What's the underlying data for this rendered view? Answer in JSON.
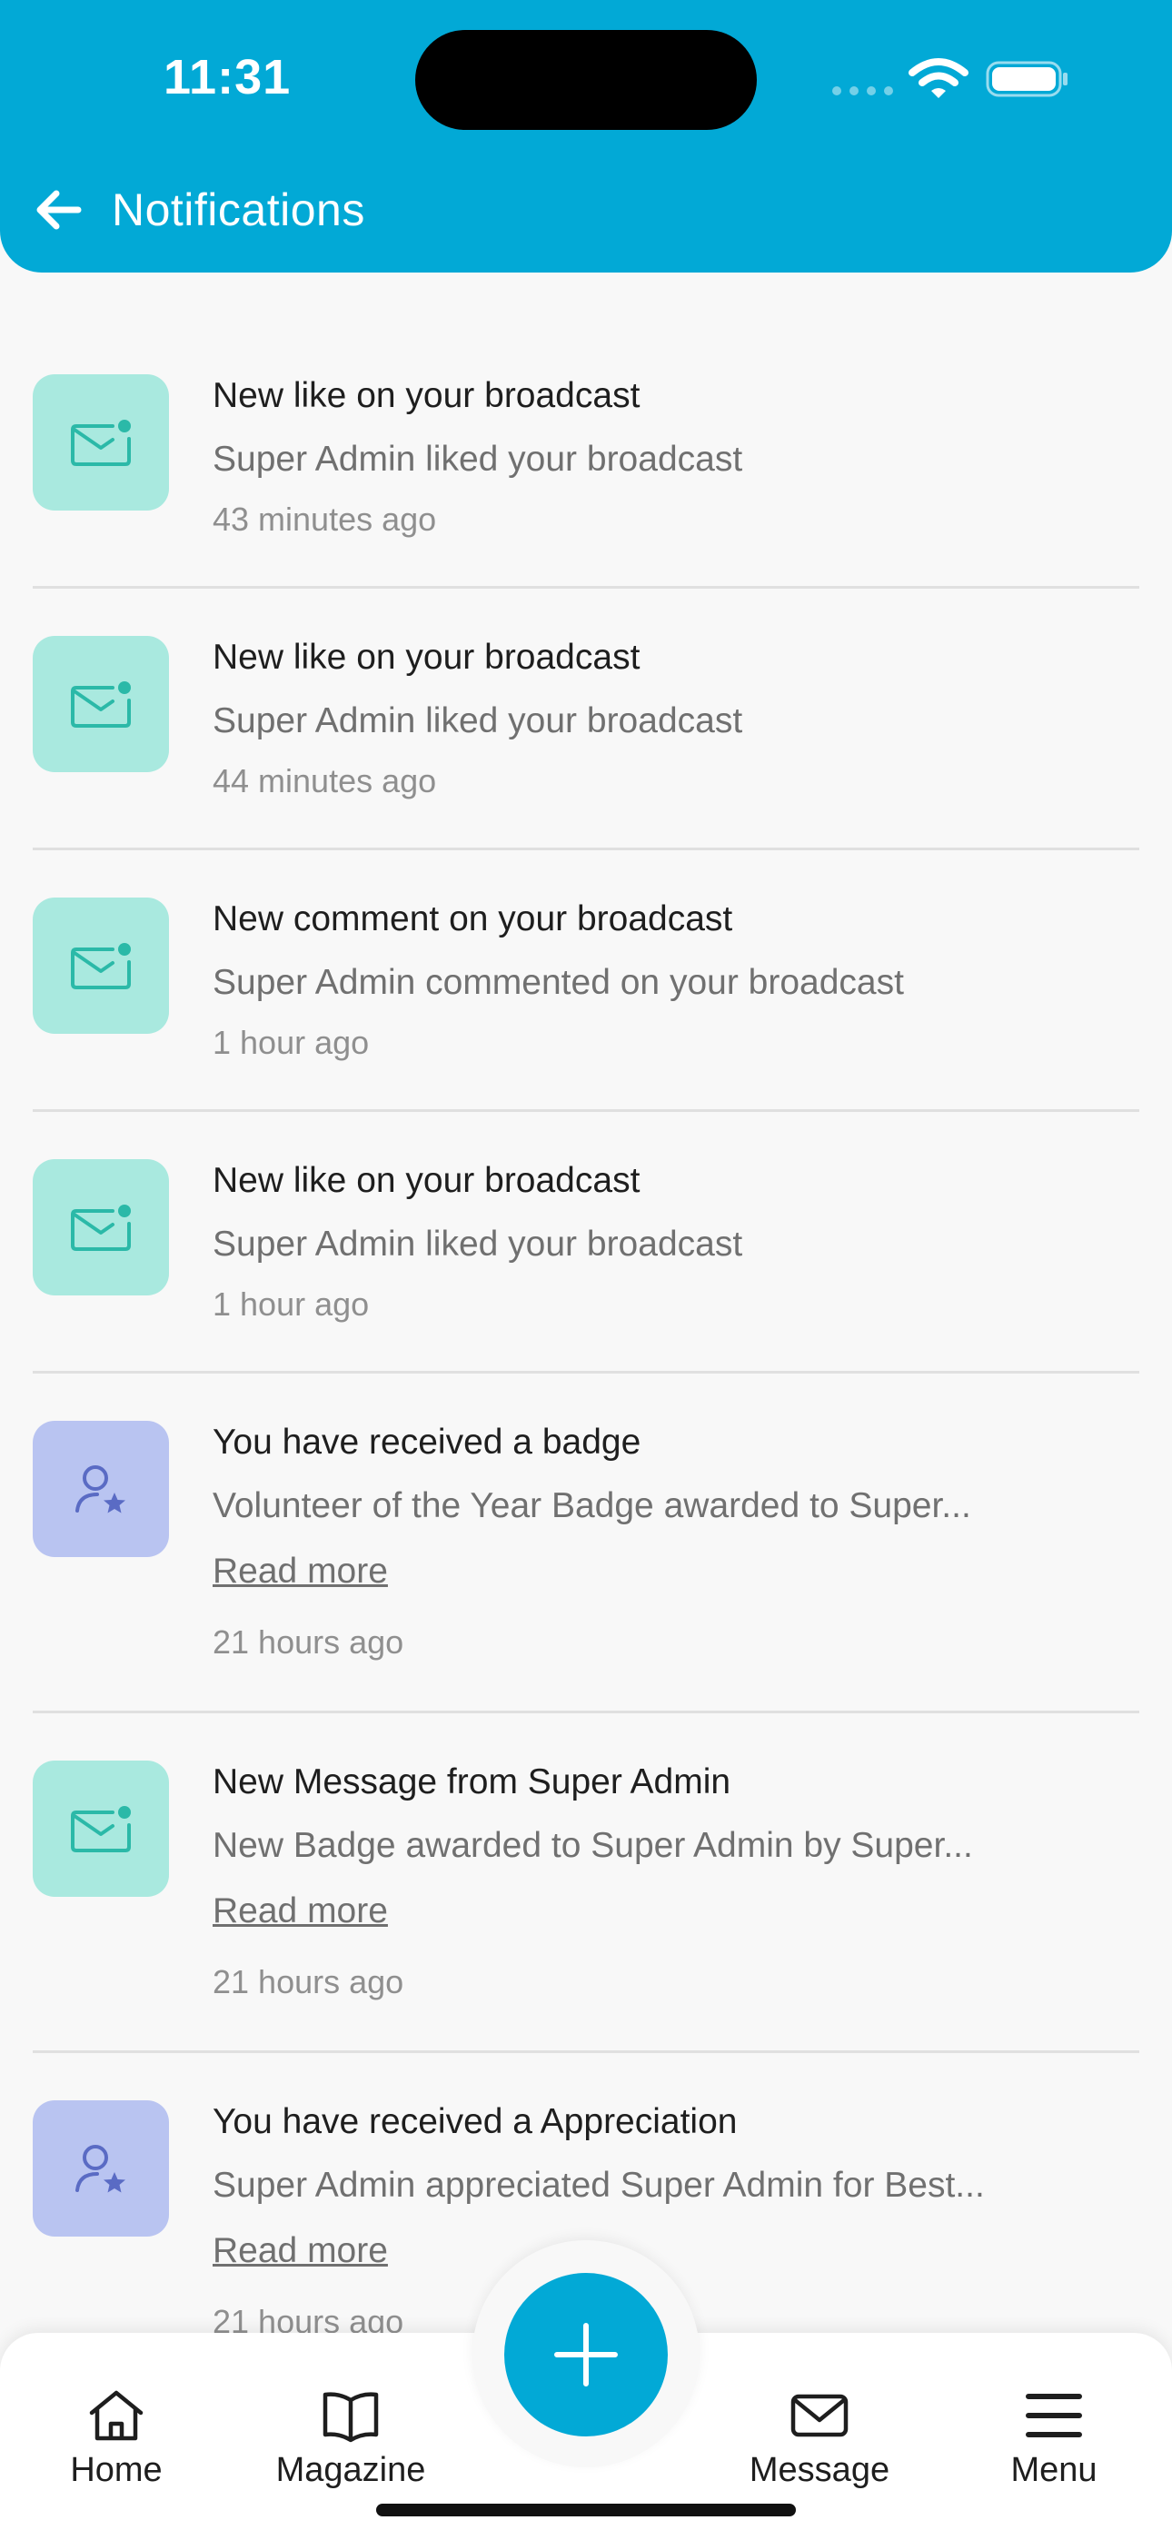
{
  "status_bar": {
    "time": "11:31"
  },
  "header": {
    "title": "Notifications"
  },
  "notifications": [
    {
      "type": "mail",
      "icon": "mail-icon",
      "title": "New like on your broadcast",
      "description": "Super Admin liked your broadcast",
      "link": "",
      "time": "43 minutes ago"
    },
    {
      "type": "mail",
      "icon": "mail-icon",
      "title": "New like on your broadcast",
      "description": "Super Admin liked your broadcast",
      "link": "",
      "time": "44 minutes ago"
    },
    {
      "type": "mail",
      "icon": "mail-icon",
      "title": "New comment on your broadcast",
      "description": "Super Admin commented on your broadcast",
      "link": "",
      "time": "1 hour ago"
    },
    {
      "type": "mail",
      "icon": "mail-icon",
      "title": "New like on your broadcast",
      "description": "Super Admin liked your broadcast",
      "link": "",
      "time": "1 hour ago"
    },
    {
      "type": "badge",
      "icon": "user-badge-icon",
      "title": "You have received a badge",
      "description": "Volunteer of the Year Badge awarded to Super...",
      "link": "Read more",
      "time": "21 hours ago"
    },
    {
      "type": "mail",
      "icon": "mail-icon",
      "title": "New Message from Super Admin",
      "description": "New Badge awarded to Super Admin by Super...",
      "link": "Read more",
      "time": "21 hours ago"
    },
    {
      "type": "badge",
      "icon": "user-badge-icon",
      "title": "You have received a Appreciation",
      "description": "Super Admin appreciated Super Admin for Best...",
      "link": "Read more",
      "time": "21 hours ago"
    }
  ],
  "bottom_nav": {
    "home": "Home",
    "magazine": "Magazine",
    "message": "Message",
    "menu": "Menu"
  },
  "colors": {
    "primary": "#02a9d6",
    "mail_tile": "#a9e9df",
    "mail_icon": "#2bb9a8",
    "badge_tile": "#b9c4f1",
    "badge_icon": "#5a6bc4"
  }
}
